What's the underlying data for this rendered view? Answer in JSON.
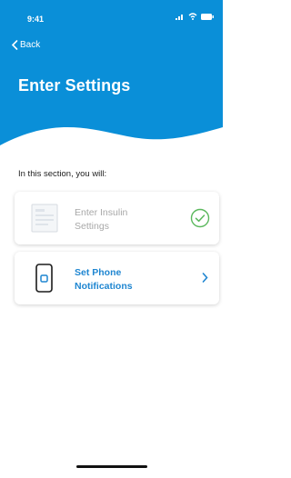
{
  "status": {
    "time": "9:41"
  },
  "nav": {
    "back_label": "Back"
  },
  "header": {
    "title": "Enter Settings"
  },
  "section": {
    "intro": "In this section, you will:"
  },
  "items": [
    {
      "label_line1": "Enter Insulin",
      "label_line2": "Settings",
      "state": "completed"
    },
    {
      "label_line1": "Set Phone",
      "label_line2": "Notifications",
      "state": "next"
    }
  ],
  "colors": {
    "header_blue": "#0a8fd8",
    "accent_blue": "#1f86d1",
    "check_green": "#5bb85d"
  }
}
